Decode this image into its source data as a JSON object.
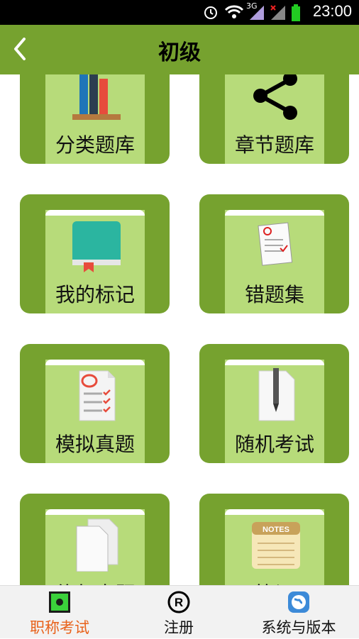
{
  "status_bar": {
    "time": "23:00",
    "network": "3G"
  },
  "header": {
    "title": "初级"
  },
  "tiles": [
    {
      "label": "分类题库",
      "icon": "books-icon"
    },
    {
      "label": "章节题库",
      "icon": "share-icon"
    },
    {
      "label": "我的标记",
      "icon": "bookmarked-book-icon"
    },
    {
      "label": "错题集",
      "icon": "graded-paper-icon"
    },
    {
      "label": "模拟真题",
      "icon": "exam-checklist-icon"
    },
    {
      "label": "随机考试",
      "icon": "pen-paper-icon"
    },
    {
      "label": "往年真题",
      "icon": "documents-icon"
    },
    {
      "label": "笔记",
      "icon": "notes-icon",
      "icon_text": "NOTES"
    }
  ],
  "bottom_nav": [
    {
      "label": "职称考试",
      "icon": "exam-tab-icon",
      "active": true
    },
    {
      "label": "注册",
      "icon": "registered-icon",
      "icon_text": "R"
    },
    {
      "label": "系统与版本",
      "icon": "globe-icon"
    }
  ],
  "colors": {
    "primary": "#76a22f",
    "tile_inner": "#b7db7a",
    "active_tab": "#e8611a"
  }
}
